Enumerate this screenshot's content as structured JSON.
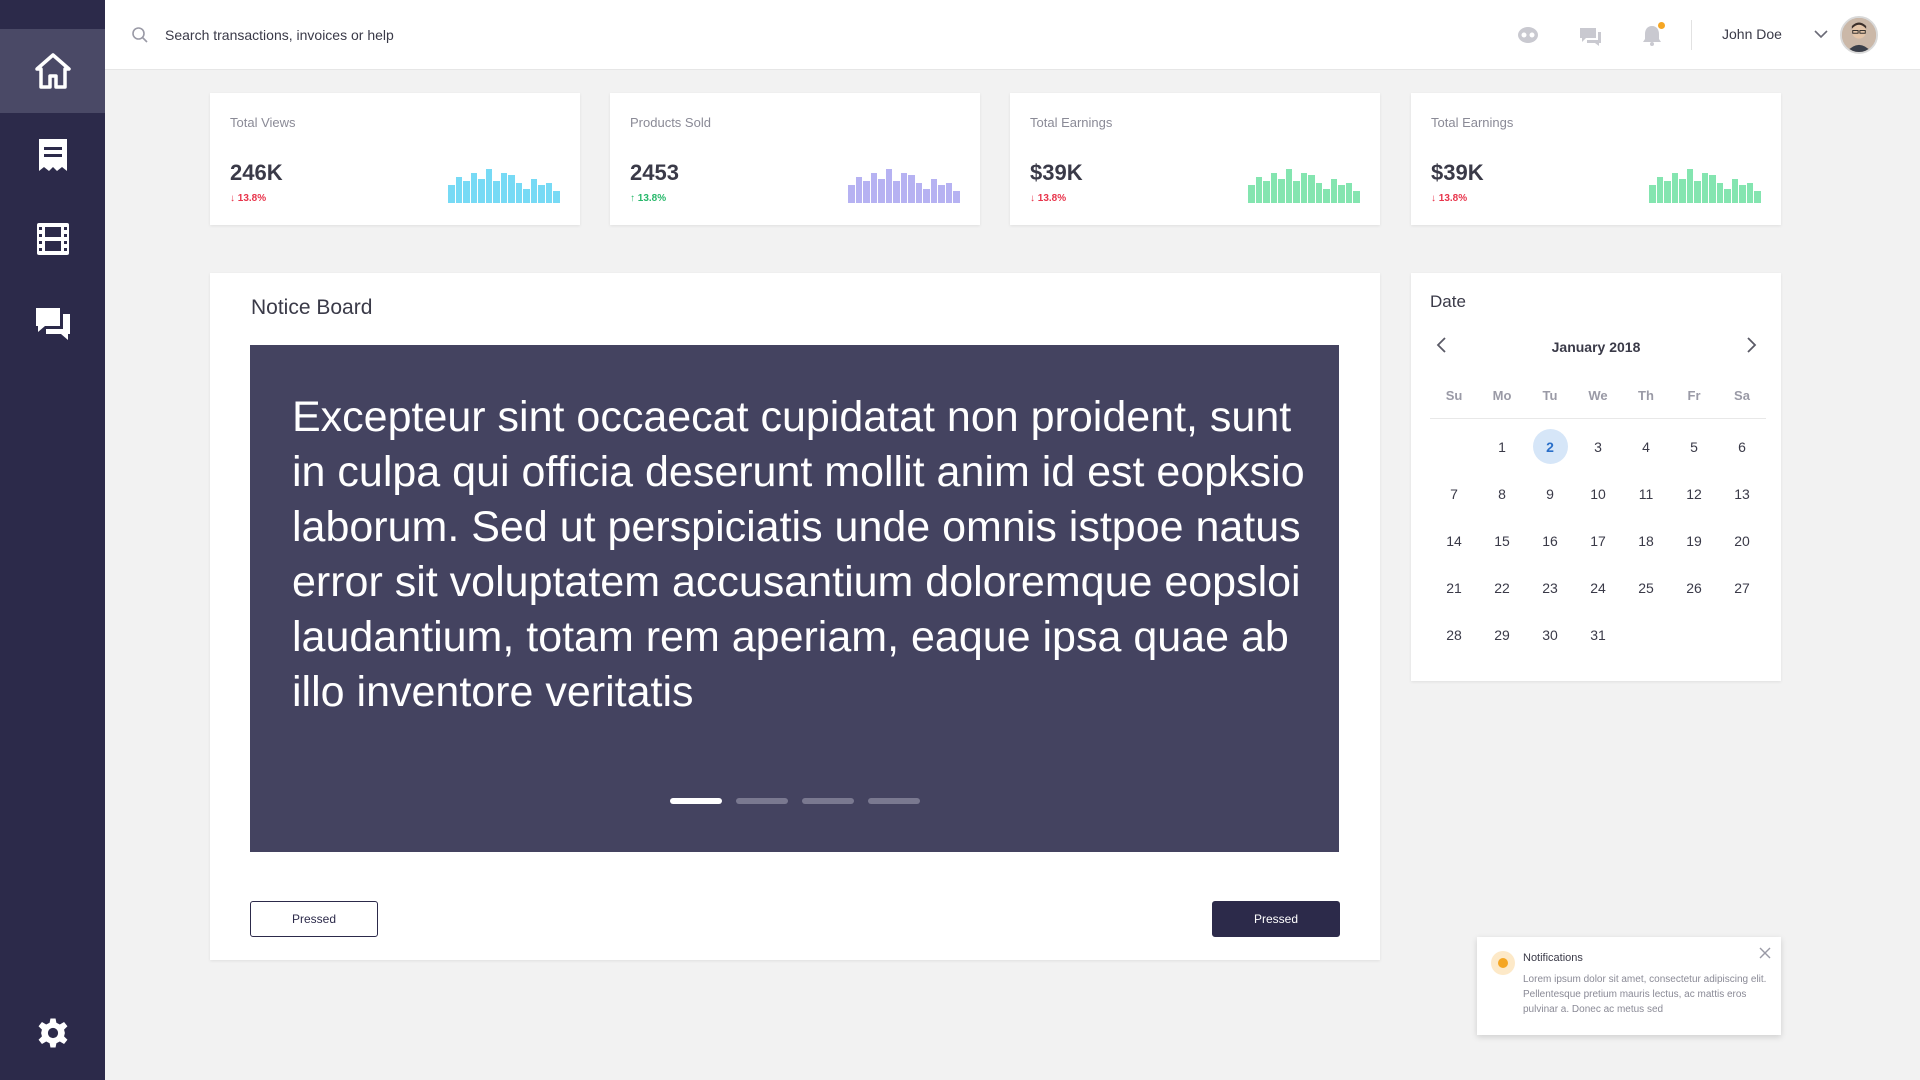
{
  "colors": {
    "sidebar_bg": "#2c2a4a",
    "sidebar_active": "#4a4966",
    "slide_bg": "#444360",
    "down": "#e8334a",
    "up": "#27b86a",
    "spark_blue": "#5fd3f3",
    "spark_purple": "#a9a4f0",
    "spark_green": "#6fe0a2",
    "notif_dot": "#f5a623"
  },
  "sidebar": {
    "items": [
      {
        "icon": "home-icon",
        "active": true
      },
      {
        "icon": "receipt-icon",
        "active": false
      },
      {
        "icon": "film-icon",
        "active": false
      },
      {
        "icon": "chat-icon",
        "active": false
      }
    ],
    "bottom": {
      "icon": "gear-icon"
    }
  },
  "topbar": {
    "search_placeholder": "Search transactions, invoices or help",
    "icons": [
      "support-icon",
      "message-icon",
      "bell-icon"
    ],
    "user_name": "John Doe"
  },
  "stats": [
    {
      "label": "Total Views",
      "value": "246K",
      "change": "13.8%",
      "direction": "down",
      "spark_color": "#5fd3f3",
      "spark": [
        0.45,
        0.65,
        0.55,
        0.75,
        0.6,
        0.85,
        0.55,
        0.75,
        0.7,
        0.5,
        0.35,
        0.6,
        0.45,
        0.5,
        0.3
      ]
    },
    {
      "label": "Products Sold",
      "value": "2453",
      "change": "13.8%",
      "direction": "up",
      "spark_color": "#a9a4f0",
      "spark": [
        0.45,
        0.65,
        0.55,
        0.75,
        0.6,
        0.85,
        0.55,
        0.75,
        0.7,
        0.5,
        0.35,
        0.6,
        0.45,
        0.5,
        0.3
      ]
    },
    {
      "label": "Total Earnings",
      "value": "$39K",
      "change": "13.8%",
      "direction": "down",
      "spark_color": "#6fe0a2",
      "spark": [
        0.45,
        0.65,
        0.55,
        0.75,
        0.6,
        0.85,
        0.55,
        0.75,
        0.7,
        0.5,
        0.35,
        0.6,
        0.45,
        0.5,
        0.3
      ]
    },
    {
      "label": "Total Earnings",
      "value": "$39K",
      "change": "13.8%",
      "direction": "down",
      "spark_color": "#6fe0a2",
      "spark": [
        0.45,
        0.65,
        0.55,
        0.75,
        0.6,
        0.85,
        0.55,
        0.75,
        0.7,
        0.5,
        0.35,
        0.6,
        0.45,
        0.5,
        0.3
      ]
    }
  ],
  "notice": {
    "title": "Notice Board",
    "text": "Excepteur sint occaecat cupidatat non proident, sunt in culpa qui officia deserunt mollit anim id est eopksio laborum. Sed ut perspiciatis unde omnis istpoe natus error sit voluptatem accusantium doloremque eopsloi laudantium, totam rem aperiam, eaque ipsa quae ab illo inventore veritatis",
    "slide_count": 4,
    "active_slide": 0,
    "btn_left": "Pressed",
    "btn_right": "Pressed"
  },
  "calendar": {
    "title": "Date",
    "month": "January 2018",
    "weekdays": [
      "Su",
      "Mo",
      "Tu",
      "We",
      "Th",
      "Fr",
      "Sa"
    ],
    "days": [
      "",
      "1",
      "2",
      "3",
      "4",
      "5",
      "6",
      "7",
      "8",
      "9",
      "10",
      "11",
      "12",
      "13",
      "14",
      "15",
      "16",
      "17",
      "18",
      "19",
      "20",
      "21",
      "22",
      "23",
      "24",
      "25",
      "26",
      "27",
      "28",
      "29",
      "30",
      "31"
    ],
    "selected": "2"
  },
  "toast": {
    "title": "Notifications",
    "body": "Lorem ipsum dolor sit amet, consectetur adipiscing elit. Pellentesque pretium mauris lectus, ac mattis eros pulvinar a. Donec ac metus sed"
  }
}
